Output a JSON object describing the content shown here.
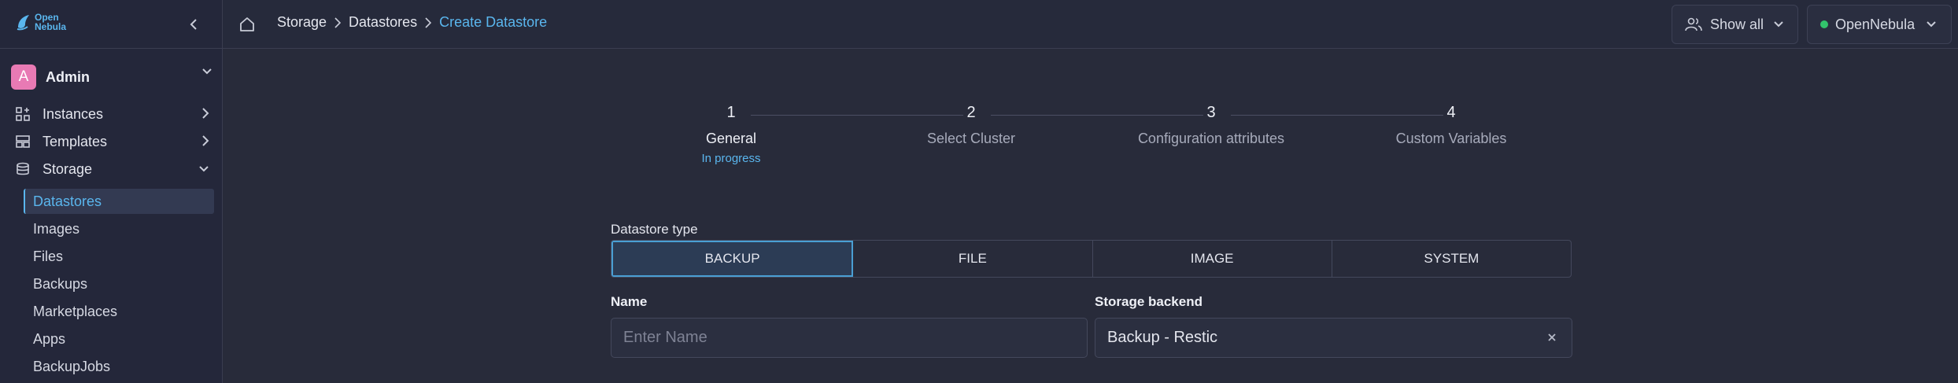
{
  "app": {
    "logo_line1": "Open",
    "logo_line2": "Nebula"
  },
  "sidebar": {
    "user": {
      "initial": "A",
      "name": "Admin"
    },
    "items": [
      {
        "label": "Instances",
        "icon": "instances-icon"
      },
      {
        "label": "Templates",
        "icon": "templates-icon"
      },
      {
        "label": "Storage",
        "icon": "storage-icon",
        "expanded": true
      }
    ],
    "storage_subitems": [
      {
        "label": "Datastores",
        "active": true
      },
      {
        "label": "Images"
      },
      {
        "label": "Files"
      },
      {
        "label": "Backups"
      },
      {
        "label": "Marketplaces"
      },
      {
        "label": "Apps"
      },
      {
        "label": "BackupJobs"
      }
    ]
  },
  "topbar": {
    "breadcrumb": [
      "Storage",
      "Datastores",
      "Create Datastore"
    ],
    "show_all_label": "Show all",
    "zone_label": "OpenNebula",
    "zone_status_color": "#32c36c"
  },
  "stepper": {
    "steps": [
      {
        "number": "1",
        "label": "General",
        "status": "In progress"
      },
      {
        "number": "2",
        "label": "Select Cluster"
      },
      {
        "number": "3",
        "label": "Configuration attributes"
      },
      {
        "number": "4",
        "label": "Custom Variables"
      }
    ]
  },
  "form": {
    "datastore_type_label": "Datastore type",
    "datastore_types": [
      "BACKUP",
      "FILE",
      "IMAGE",
      "SYSTEM"
    ],
    "selected_type": "BACKUP",
    "name_label": "Name",
    "name_placeholder": "Enter Name",
    "storage_backend_label": "Storage backend",
    "storage_backend_value": "Backup - Restic"
  },
  "colors": {
    "accent": "#5ab6ee",
    "background": "#282b3a",
    "avatar": "#e87ab4"
  }
}
